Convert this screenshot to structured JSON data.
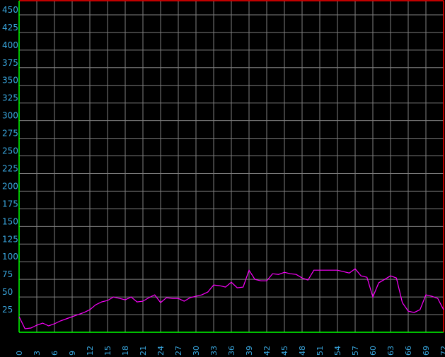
{
  "chart_data": {
    "type": "line",
    "title": "",
    "xlabel": "",
    "ylabel": "",
    "xlim": [
      0,
      72
    ],
    "ylim": [
      0,
      470
    ],
    "grid": true,
    "colors": {
      "background": "#000000",
      "grid": "#808080",
      "frame_top_right": "#ff0000",
      "frame_bottom_left": "#00ff00",
      "series": "#ff00ff",
      "ticks": "#3aa8e0"
    },
    "y_ticks": [
      25,
      50,
      75,
      100,
      125,
      150,
      175,
      200,
      225,
      250,
      275,
      300,
      325,
      350,
      375,
      400,
      425,
      450
    ],
    "x_ticks": [
      0,
      3,
      6,
      9,
      12,
      15,
      18,
      21,
      24,
      27,
      30,
      33,
      36,
      39,
      42,
      45,
      48,
      51,
      54,
      57,
      60,
      63,
      66,
      69,
      72
    ],
    "x": [
      0,
      1,
      2,
      3,
      4,
      5,
      6,
      7,
      8,
      9,
      10,
      11,
      12,
      13,
      14,
      15,
      16,
      17,
      18,
      19,
      20,
      21,
      22,
      23,
      24,
      25,
      26,
      27,
      28,
      29,
      30,
      31,
      32,
      33,
      34,
      35,
      36,
      37,
      38,
      39,
      40,
      41,
      42,
      43,
      44,
      45,
      46,
      47,
      48,
      49,
      50,
      51,
      52,
      53,
      54,
      55,
      56,
      57,
      58,
      59,
      60,
      61,
      62,
      63,
      64,
      65,
      66,
      67,
      68,
      69,
      70,
      71,
      72
    ],
    "series": [
      {
        "values": [
          22,
          5,
          6,
          10,
          13,
          9,
          12,
          16,
          19,
          22,
          25,
          28,
          32,
          39,
          43,
          45,
          50,
          48,
          46,
          50,
          43,
          44,
          49,
          53,
          42,
          49,
          48,
          48,
          44,
          49,
          51,
          53,
          57,
          67,
          66,
          64,
          71,
          63,
          64,
          88,
          75,
          73,
          73,
          83,
          82,
          85,
          83,
          82,
          77,
          74,
          88,
          88,
          88,
          88,
          88,
          86,
          84,
          90,
          80,
          78,
          50,
          70,
          75,
          80,
          77,
          42,
          30,
          28,
          32,
          53,
          51,
          48,
          32
        ]
      }
    ]
  }
}
